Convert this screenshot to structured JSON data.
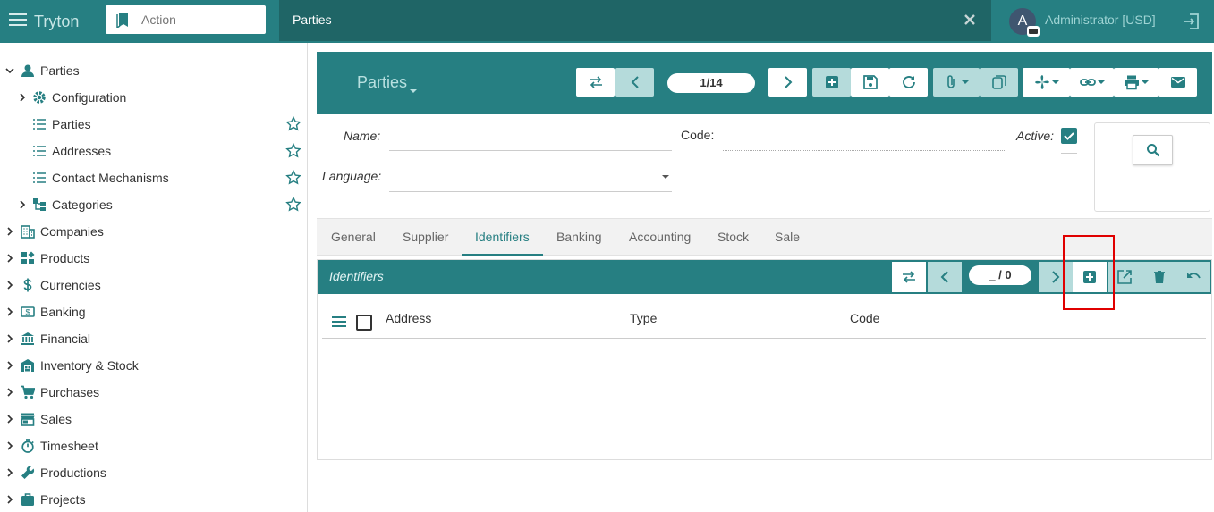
{
  "app": {
    "brand": "Tryton"
  },
  "action_search": {
    "placeholder": "Action"
  },
  "tab": {
    "label": "Parties"
  },
  "user": {
    "initial": "A",
    "name": "Administrator [USD]"
  },
  "sidebar": {
    "items": [
      {
        "label": "Parties",
        "icon": "person-icon",
        "level": 0,
        "expanded": true
      },
      {
        "label": "Configuration",
        "icon": "gear-icon",
        "level": 1
      },
      {
        "label": "Parties",
        "icon": "list-icon",
        "level": 1,
        "favorite": true
      },
      {
        "label": "Addresses",
        "icon": "list-icon",
        "level": 1,
        "favorite": true
      },
      {
        "label": "Contact Mechanisms",
        "icon": "list-icon",
        "level": 1,
        "favorite": true
      },
      {
        "label": "Categories",
        "icon": "tree-icon",
        "level": 1,
        "favorite": true
      },
      {
        "label": "Companies",
        "icon": "building-icon",
        "level": 0
      },
      {
        "label": "Products",
        "icon": "products-icon",
        "level": 0
      },
      {
        "label": "Currencies",
        "icon": "dollar-icon",
        "level": 0
      },
      {
        "label": "Banking",
        "icon": "banking-icon",
        "level": 0
      },
      {
        "label": "Financial",
        "icon": "bank-icon",
        "level": 0
      },
      {
        "label": "Inventory & Stock",
        "icon": "warehouse-icon",
        "level": 0
      },
      {
        "label": "Purchases",
        "icon": "cart-icon",
        "level": 0
      },
      {
        "label": "Sales",
        "icon": "store-icon",
        "level": 0
      },
      {
        "label": "Timesheet",
        "icon": "stopwatch-icon",
        "level": 0
      },
      {
        "label": "Productions",
        "icon": "wrench-icon",
        "level": 0
      },
      {
        "label": "Projects",
        "icon": "briefcase-icon",
        "level": 0
      }
    ]
  },
  "form": {
    "title": "Parties",
    "record_counter": "1/14",
    "fields": {
      "name_label": "Name:",
      "name_value": "",
      "code_label": "Code:",
      "code_value": "",
      "active_label": "Active:",
      "active_checked": true,
      "language_label": "Language:",
      "language_value": ""
    },
    "tabs": [
      "General",
      "Supplier",
      "Identifiers",
      "Banking",
      "Accounting",
      "Stock",
      "Sale"
    ],
    "active_tab": "Identifiers"
  },
  "identifiers": {
    "title": "Identifiers",
    "counter": "_ / 0",
    "columns": [
      "Address",
      "Type",
      "Code"
    ],
    "rows": []
  },
  "colors": {
    "primary": "#267f82",
    "primary_dark": "#1f6566",
    "highlight": "#e00000"
  }
}
